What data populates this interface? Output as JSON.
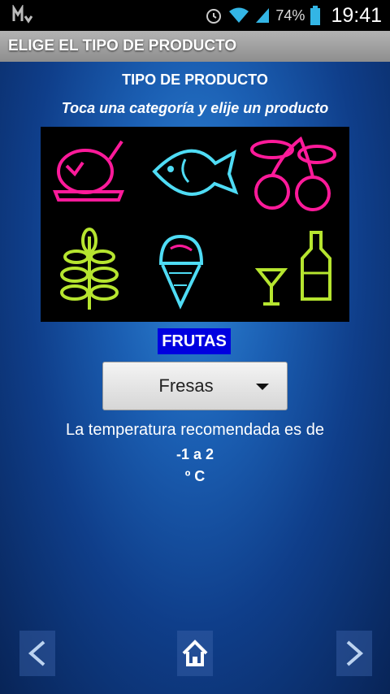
{
  "status_bar": {
    "battery_percent": "74%",
    "time": "19:41"
  },
  "title_bar": {
    "title": "ELIGE EL TIPO DE PRODUCTO"
  },
  "main": {
    "heading": "TIPO DE PRODUCTO",
    "subheading": "Toca una categoría y elije un producto",
    "categories": [
      "meat-icon",
      "fish-icon",
      "fruit-icon",
      "grain-icon",
      "icecream-icon",
      "drinks-icon"
    ],
    "selected_category": "FRUTAS",
    "dropdown": {
      "selected": "Fresas"
    },
    "temperature_text": "La temperatura recomendada es de",
    "temperature_range": "-1 a 2",
    "temperature_unit": "º C"
  },
  "nav": {
    "icons": [
      "prev-arrow-icon",
      "home-icon",
      "next-arrow-icon"
    ]
  }
}
